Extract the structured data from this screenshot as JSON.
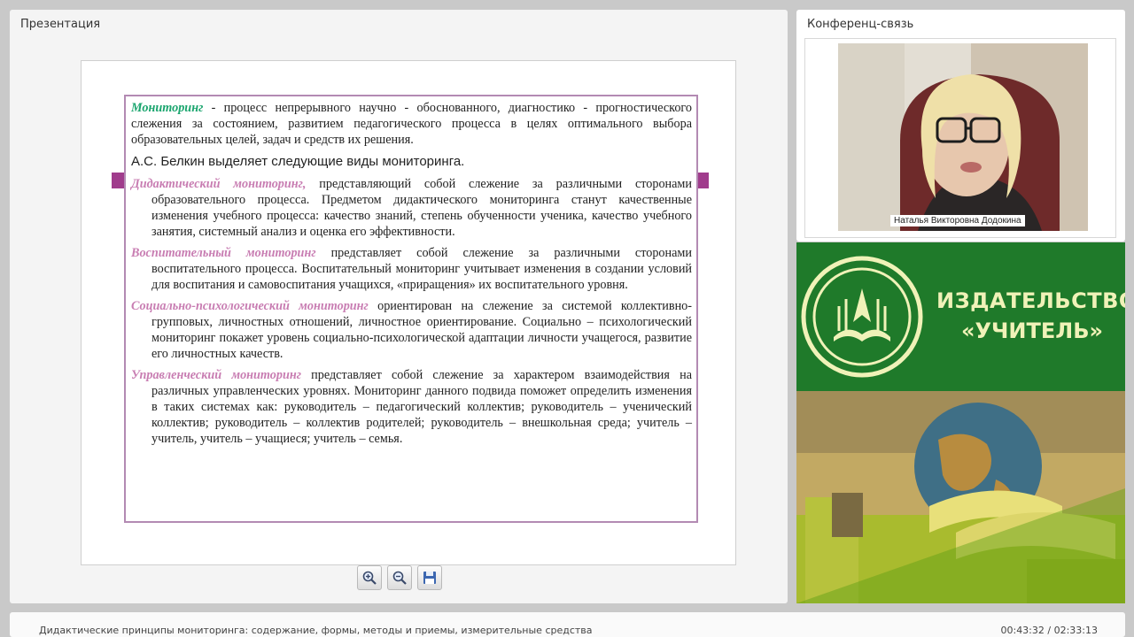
{
  "presentation": {
    "title": "Презентация",
    "slide": {
      "p1_term": "Мониторинг",
      "p1_text": " - процесс непрерывного научно - обоснованного, диагностико - прогностического слежения за состоянием, развитием педагогического процесса в целях оптимального выбора образовательных целей, задач и средств их решения.",
      "subtitle": "А.С. Белкин выделяет следующие виды мониторинга.",
      "items": [
        {
          "term": "Дидактический мониторинг,",
          "text": " представляющий собой слежение за различными сторонами образовательного процесса. Предметом дидактического мониторинга станут качественные изменения учебного процесса: качество знаний, степень обученности ученика, качество учебного занятия, системный анализ и оценка его эффективности."
        },
        {
          "term": "Воспитательный мониторинг",
          "text": " представляет собой слежение за различными сторонами воспитательного процесса. Воспитательный мониторинг учитывает изменения в создании условий для воспитания и самовоспитания учащихся, «приращения» их воспитательного уровня."
        },
        {
          "term": "Социально-психологический мониторинг",
          "text": " ориентирован на слежение за системой коллективно-групповых, личностных отношений, личностное ориентирование. Социально – психологический мониторинг покажет уровень социально-психологической адаптации личности учащегося, развитие его личностных качеств."
        },
        {
          "term": "Управленческий мониторинг",
          "text": " представляет собой слежение за характером взаимодействия на различных управленческих уровнях. Мониторинг данного подвида поможет определить изменения в таких системах как: руководитель – педагогический коллектив; руководитель – ученический коллектив; руководитель – коллектив родителей; руководитель – внешкольная среда; учитель – учитель, учитель – учащиеся; учитель – семья."
        }
      ]
    },
    "toolbar": {
      "zoom_in_icon": "zoom-in-icon",
      "zoom_out_icon": "zoom-out-icon",
      "save_icon": "save-icon"
    }
  },
  "conference": {
    "title": "Конференц-связь",
    "participant_name": "Наталья Викторовна Додокина"
  },
  "logo": {
    "line1": "ИЗДАТЕЛЬСТВО",
    "line2": "«УЧИТЕЛЬ»"
  },
  "footer": {
    "lecture_title": "Дидактические принципы мониторинга: содержание, формы, методы и приемы, измерительные средства",
    "timer": "00:43:32 / 02:33:13"
  },
  "colors": {
    "term_green": "#1aa56e",
    "term_pink": "#c87db2",
    "frame": "#b38ab3",
    "logo_green": "#1f7a2a",
    "logo_text": "#f0f2b8"
  }
}
